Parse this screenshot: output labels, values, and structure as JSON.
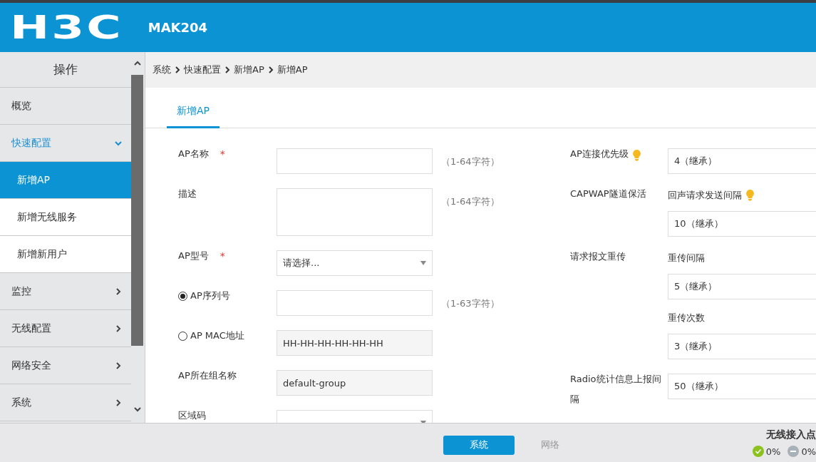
{
  "header": {
    "logo": "H3C",
    "device": "MAK204"
  },
  "sidebar": {
    "title": "操作",
    "items": [
      {
        "label": "概览"
      },
      {
        "label": "快速配置",
        "expanded": true,
        "children": [
          {
            "label": "新增AP",
            "selected": true
          },
          {
            "label": "新增无线服务",
            "selected": false
          },
          {
            "label": "新增新用户",
            "selected": false
          }
        ]
      },
      {
        "label": "监控",
        "expanded": false
      },
      {
        "label": "无线配置",
        "expanded": false
      },
      {
        "label": "网络安全",
        "expanded": false
      },
      {
        "label": "系统",
        "expanded": false
      }
    ]
  },
  "breadcrumb": [
    "系统",
    "快速配置",
    "新增AP",
    "新增AP"
  ],
  "tabs": [
    {
      "label": "新增AP",
      "selected": true
    }
  ],
  "left_fields": [
    {
      "kind": "text",
      "label": "AP名称",
      "required_mark": "*",
      "hint": "（1-64字符）"
    },
    {
      "kind": "textarea",
      "label": "描述",
      "hint": "（1-64字符）"
    },
    {
      "kind": "select",
      "label": "AP型号",
      "required_mark": "*",
      "placeholder": "请选择..."
    },
    {
      "kind": "radio",
      "label": "AP序列号",
      "selected": true,
      "hint": "（1-63字符）"
    },
    {
      "kind": "radio",
      "label": "AP MAC地址",
      "selected": false,
      "placeholder": "HH-HH-HH-HH-HH-HH"
    },
    {
      "kind": "readonly",
      "label": "AP所在组名称",
      "value": "default-group"
    },
    {
      "kind": "select",
      "label": "区域码"
    }
  ],
  "right_fields": [
    {
      "label": "AP连接优先级",
      "tip": true,
      "inputs": [
        {
          "value": "4（继承）"
        }
      ]
    },
    {
      "label": "CAPWAP隧道保活",
      "inputs": [
        {
          "sublabel": "回声请求发送间隔",
          "tip": true,
          "value": "10（继承）"
        }
      ]
    },
    {
      "label": "请求报文重传",
      "inputs": [
        {
          "sublabel": "重传间隔",
          "value": "5（继承）"
        },
        {
          "sublabel": "重传次数",
          "value": "3（继承）"
        }
      ]
    },
    {
      "label": "Radio统计信息上报间隔",
      "inputs": [
        {
          "value": "50（继承）"
        }
      ]
    }
  ],
  "footer": {
    "tabs": [
      {
        "label": "系统",
        "selected": true
      },
      {
        "label": "网络",
        "selected": false
      }
    ],
    "status_title": "无线接入点",
    "stats": [
      {
        "kind": "ok",
        "value": "0%"
      },
      {
        "kind": "off",
        "value": "0%"
      }
    ]
  }
}
